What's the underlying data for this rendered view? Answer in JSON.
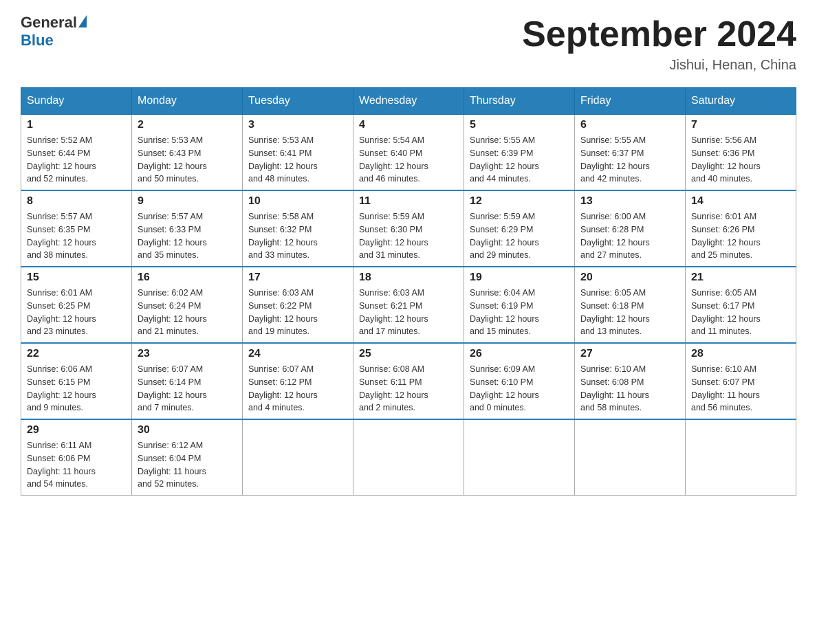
{
  "logo": {
    "general": "General",
    "blue": "Blue"
  },
  "title": "September 2024",
  "subtitle": "Jishui, Henan, China",
  "weekdays": [
    "Sunday",
    "Monday",
    "Tuesday",
    "Wednesday",
    "Thursday",
    "Friday",
    "Saturday"
  ],
  "weeks": [
    [
      {
        "day": "1",
        "sunrise": "5:52 AM",
        "sunset": "6:44 PM",
        "daylight": "12 hours and 52 minutes."
      },
      {
        "day": "2",
        "sunrise": "5:53 AM",
        "sunset": "6:43 PM",
        "daylight": "12 hours and 50 minutes."
      },
      {
        "day": "3",
        "sunrise": "5:53 AM",
        "sunset": "6:41 PM",
        "daylight": "12 hours and 48 minutes."
      },
      {
        "day": "4",
        "sunrise": "5:54 AM",
        "sunset": "6:40 PM",
        "daylight": "12 hours and 46 minutes."
      },
      {
        "day": "5",
        "sunrise": "5:55 AM",
        "sunset": "6:39 PM",
        "daylight": "12 hours and 44 minutes."
      },
      {
        "day": "6",
        "sunrise": "5:55 AM",
        "sunset": "6:37 PM",
        "daylight": "12 hours and 42 minutes."
      },
      {
        "day": "7",
        "sunrise": "5:56 AM",
        "sunset": "6:36 PM",
        "daylight": "12 hours and 40 minutes."
      }
    ],
    [
      {
        "day": "8",
        "sunrise": "5:57 AM",
        "sunset": "6:35 PM",
        "daylight": "12 hours and 38 minutes."
      },
      {
        "day": "9",
        "sunrise": "5:57 AM",
        "sunset": "6:33 PM",
        "daylight": "12 hours and 35 minutes."
      },
      {
        "day": "10",
        "sunrise": "5:58 AM",
        "sunset": "6:32 PM",
        "daylight": "12 hours and 33 minutes."
      },
      {
        "day": "11",
        "sunrise": "5:59 AM",
        "sunset": "6:30 PM",
        "daylight": "12 hours and 31 minutes."
      },
      {
        "day": "12",
        "sunrise": "5:59 AM",
        "sunset": "6:29 PM",
        "daylight": "12 hours and 29 minutes."
      },
      {
        "day": "13",
        "sunrise": "6:00 AM",
        "sunset": "6:28 PM",
        "daylight": "12 hours and 27 minutes."
      },
      {
        "day": "14",
        "sunrise": "6:01 AM",
        "sunset": "6:26 PM",
        "daylight": "12 hours and 25 minutes."
      }
    ],
    [
      {
        "day": "15",
        "sunrise": "6:01 AM",
        "sunset": "6:25 PM",
        "daylight": "12 hours and 23 minutes."
      },
      {
        "day": "16",
        "sunrise": "6:02 AM",
        "sunset": "6:24 PM",
        "daylight": "12 hours and 21 minutes."
      },
      {
        "day": "17",
        "sunrise": "6:03 AM",
        "sunset": "6:22 PM",
        "daylight": "12 hours and 19 minutes."
      },
      {
        "day": "18",
        "sunrise": "6:03 AM",
        "sunset": "6:21 PM",
        "daylight": "12 hours and 17 minutes."
      },
      {
        "day": "19",
        "sunrise": "6:04 AM",
        "sunset": "6:19 PM",
        "daylight": "12 hours and 15 minutes."
      },
      {
        "day": "20",
        "sunrise": "6:05 AM",
        "sunset": "6:18 PM",
        "daylight": "12 hours and 13 minutes."
      },
      {
        "day": "21",
        "sunrise": "6:05 AM",
        "sunset": "6:17 PM",
        "daylight": "12 hours and 11 minutes."
      }
    ],
    [
      {
        "day": "22",
        "sunrise": "6:06 AM",
        "sunset": "6:15 PM",
        "daylight": "12 hours and 9 minutes."
      },
      {
        "day": "23",
        "sunrise": "6:07 AM",
        "sunset": "6:14 PM",
        "daylight": "12 hours and 7 minutes."
      },
      {
        "day": "24",
        "sunrise": "6:07 AM",
        "sunset": "6:12 PM",
        "daylight": "12 hours and 4 minutes."
      },
      {
        "day": "25",
        "sunrise": "6:08 AM",
        "sunset": "6:11 PM",
        "daylight": "12 hours and 2 minutes."
      },
      {
        "day": "26",
        "sunrise": "6:09 AM",
        "sunset": "6:10 PM",
        "daylight": "12 hours and 0 minutes."
      },
      {
        "day": "27",
        "sunrise": "6:10 AM",
        "sunset": "6:08 PM",
        "daylight": "11 hours and 58 minutes."
      },
      {
        "day": "28",
        "sunrise": "6:10 AM",
        "sunset": "6:07 PM",
        "daylight": "11 hours and 56 minutes."
      }
    ],
    [
      {
        "day": "29",
        "sunrise": "6:11 AM",
        "sunset": "6:06 PM",
        "daylight": "11 hours and 54 minutes."
      },
      {
        "day": "30",
        "sunrise": "6:12 AM",
        "sunset": "6:04 PM",
        "daylight": "11 hours and 52 minutes."
      },
      null,
      null,
      null,
      null,
      null
    ]
  ],
  "labels": {
    "sunrise": "Sunrise:",
    "sunset": "Sunset:",
    "daylight": "Daylight:"
  }
}
